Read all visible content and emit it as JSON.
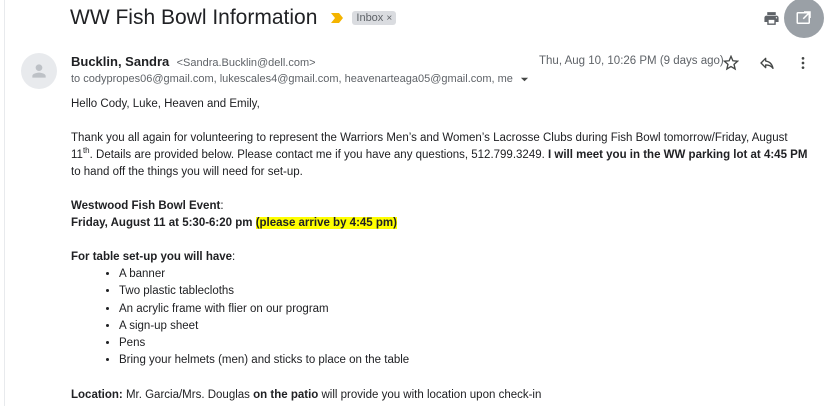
{
  "header": {
    "subject": "WW Fish Bowl Information",
    "label": "Inbox",
    "label_close": "×"
  },
  "message": {
    "sender_name": "Bucklin, Sandra",
    "sender_email": "<Sandra.Bucklin@dell.com>",
    "recipients": "to codypropes06@gmail.com, lukescales4@gmail.com, heavenarteaga05@gmail.com, me",
    "date": "Thu, Aug 10, 10:26 PM (9 days ago)"
  },
  "body": {
    "greeting": "Hello Cody, Luke, Heaven and Emily,",
    "intro_a": "Thank you all again for volunteering to represent the Warriors Men’s and Women’s Lacrosse Clubs during Fish Bowl tomorrow/Friday, August 11",
    "intro_sup": "th",
    "intro_b": ". Details are provided below. Please contact me if you have any questions, 512.799.3249.  ",
    "intro_bold": "I will meet you in the WW parking lot at 4:45 PM",
    "intro_c": " to hand off the things you will need for set-up.",
    "event_label": "Westwood Fish Bowl Event",
    "event_colon": ":",
    "event_time": "Friday, August 11 at 5:30-6:20 pm ",
    "event_note": "(please arrive by 4:45 pm)",
    "setup_label": "For table set-up you will have",
    "setup_colon": ":",
    "items": [
      "A banner",
      "Two plastic tablecloths",
      "An acrylic frame with flier on our program",
      "A sign-up sheet",
      "Pens",
      "Bring your helmets (men) and sticks to place on the table"
    ],
    "location_label": "Location:",
    "location_a": " Mr. Garcia/Mrs. Douglas ",
    "location_bold": "on the patio",
    "location_b": " will provide you with location upon check-in"
  },
  "colors": {
    "accent_importance": "#f4b400",
    "highlight": "#ffff00",
    "popout_bg": "#9aa0a6"
  },
  "icons": [
    "importance-marker-icon",
    "print-icon",
    "open-in-new-window-icon",
    "person-icon",
    "star-icon",
    "reply-icon",
    "more-vert-icon",
    "chevron-down-icon"
  ]
}
